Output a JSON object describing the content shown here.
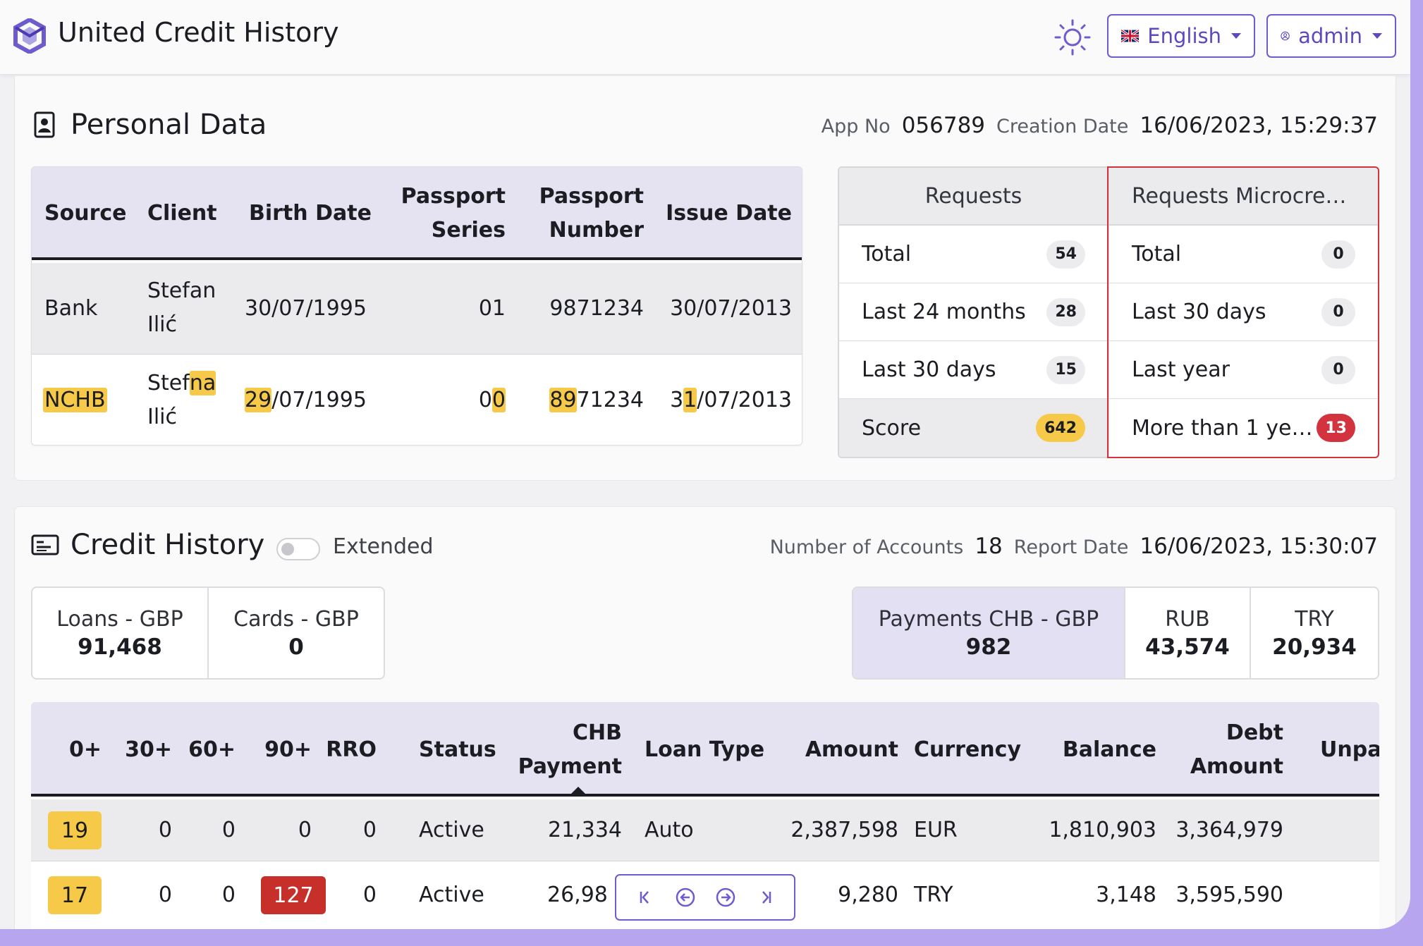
{
  "app": {
    "title": "United Credit History"
  },
  "header": {
    "language": "English",
    "user": "admin"
  },
  "personal": {
    "title": "Personal Data",
    "app_no_label": "App No",
    "app_no": "056789",
    "creation_label": "Creation Date",
    "creation_date": "16/06/2023, 15:29:37",
    "columns": {
      "source": "Source",
      "client": "Client",
      "birth_date": "Birth Date",
      "passport_series_1": "Passport",
      "passport_series_2": "Series",
      "passport_number_1": "Passport",
      "passport_number_2": "Number",
      "issue_date": "Issue Date"
    },
    "rows": [
      {
        "source": "Bank",
        "client_first": "Stefan",
        "client_last": "Ilić",
        "birth_date": "30/07/1995",
        "passport_series": "01",
        "passport_number": "9871234",
        "issue_date": "30/07/2013"
      },
      {
        "source": "NCHB",
        "client_first_a": "Stef",
        "client_first_hl": "na",
        "client_last": "Ilić",
        "birth_hl": "29",
        "birth_rest": "/07/1995",
        "series_a": "0",
        "series_hl": "0",
        "number_hl": "89",
        "number_rest": "71234",
        "issue_a": "3",
        "issue_hl": "1",
        "issue_rest": "/07/2013"
      }
    ]
  },
  "requests": {
    "left": {
      "title": "Requests",
      "rows": [
        {
          "label": "Total",
          "value": "54"
        },
        {
          "label": "Last 24 months",
          "value": "28"
        },
        {
          "label": "Last 30 days",
          "value": "15"
        },
        {
          "label": "Score",
          "value": "642"
        }
      ]
    },
    "right": {
      "title": "Requests Microcre…",
      "rows": [
        {
          "label": "Total",
          "value": "0"
        },
        {
          "label": "Last 30 days",
          "value": "0"
        },
        {
          "label": "Last year",
          "value": "0"
        },
        {
          "label": "More than 1 ye…",
          "value": "13"
        }
      ]
    }
  },
  "credit": {
    "title": "Credit History",
    "extended_label": "Extended",
    "accounts_label": "Number of Accounts",
    "accounts": "18",
    "report_label": "Report Date",
    "report_date": "16/06/2023, 15:30:07",
    "totals_left": [
      {
        "label": "Loans - GBP",
        "value": "91,468"
      },
      {
        "label": "Cards - GBP",
        "value": "0"
      }
    ],
    "totals_right": [
      {
        "label": "Payments CHB - GBP",
        "value": "982"
      },
      {
        "label": "RUB",
        "value": "43,574"
      },
      {
        "label": "TRY",
        "value": "20,934"
      }
    ],
    "columns": {
      "c0": "0+",
      "c30": "30+",
      "c60": "60+",
      "c90": "90+",
      "rro": "RRO",
      "status": "Status",
      "chb_1": "CHB",
      "chb_2": "Payment",
      "loan_type": "Loan Type",
      "amount": "Amount",
      "currency": "Currency",
      "balance": "Balance",
      "debt_1": "Debt",
      "debt_2": "Amount",
      "unpaid": "Unpa"
    },
    "rows": [
      {
        "c0": "19",
        "c30": "0",
        "c60": "0",
        "c90": "0",
        "rro": "0",
        "status": "Active",
        "chb": "21,334",
        "loan_type": "Auto",
        "amount": "2,387,598",
        "currency": "EUR",
        "balance": "1,810,903",
        "debt": "3,364,979"
      },
      {
        "c0": "17",
        "c30": "0",
        "c60": "0",
        "c90": "127",
        "rro": "0",
        "status": "Active",
        "chb": "26,98",
        "loan_type": "",
        "amount": "9,280",
        "currency": "TRY",
        "balance": "3,148",
        "debt": "3,595,590"
      }
    ]
  },
  "colors": {
    "accent": "#6e5ccf",
    "highlight": "#f7c948",
    "danger": "#c62f2a",
    "header_bg": "#e5e2f2"
  }
}
